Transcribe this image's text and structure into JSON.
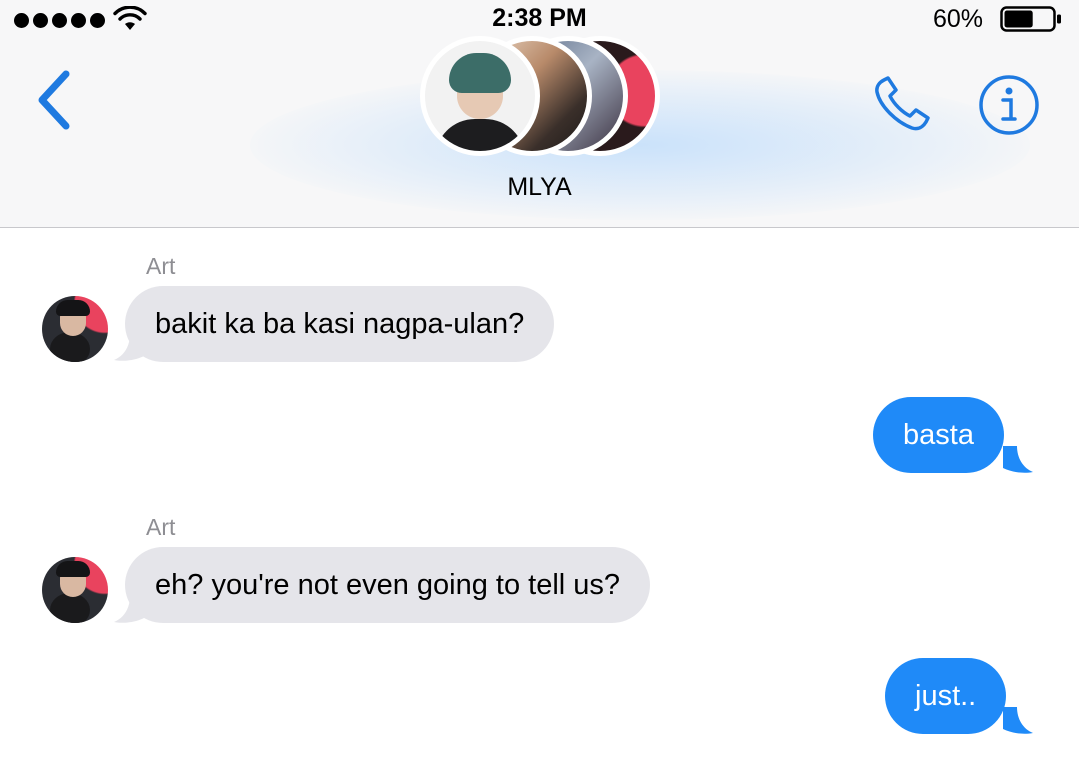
{
  "status_bar": {
    "time": "2:38 PM",
    "battery_percent": "60%",
    "battery_level": 0.6,
    "signal_bars": 5
  },
  "header": {
    "group_name": "MLYA",
    "participant_avatar_count": 4,
    "back_icon": "chevron-left-icon",
    "call_icon": "phone-icon",
    "info_icon": "info-icon",
    "accent_color": "#1f8af8"
  },
  "messages": [
    {
      "direction": "incoming",
      "sender": "Art",
      "text": "bakit ka ba kasi nagpa-ulan?"
    },
    {
      "direction": "outgoing",
      "text": "basta"
    },
    {
      "direction": "incoming",
      "sender": "Art",
      "text": "eh? you're not even going to tell us?"
    },
    {
      "direction": "outgoing",
      "text": "just.."
    }
  ],
  "colors": {
    "incoming_bubble": "#e5e5ea",
    "outgoing_bubble": "#1f8af8",
    "sender_name": "#8e8e93"
  }
}
